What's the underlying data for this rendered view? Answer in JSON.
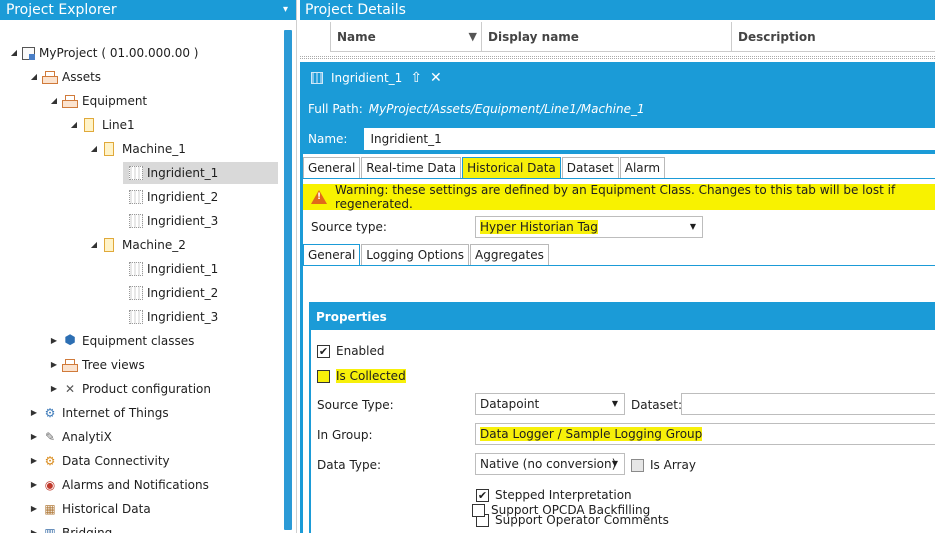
{
  "explorer": {
    "title": "Project Explorer",
    "pin": "▾",
    "nodes": [
      {
        "label": "MyProject ( 01.00.000.00 )",
        "icon": "project-icon",
        "expander": "◢"
      },
      {
        "label": "Assets",
        "icon": "assets-icon",
        "expander": "◢"
      },
      {
        "label": "Equipment",
        "icon": "equipment-icon",
        "expander": "◢"
      },
      {
        "label": "Line1",
        "icon": "line-icon",
        "expander": "◢"
      },
      {
        "label": "Machine_1",
        "icon": "machine-icon",
        "expander": "◢"
      },
      {
        "label": "Ingridient_1",
        "icon": "ingredient-icon",
        "selected": true
      },
      {
        "label": "Ingridient_2",
        "icon": "ingredient-icon"
      },
      {
        "label": "Ingridient_3",
        "icon": "ingredient-icon"
      },
      {
        "label": "Machine_2",
        "icon": "machine-icon",
        "expander": "◢"
      },
      {
        "label": "Ingridient_1",
        "icon": "ingredient-icon"
      },
      {
        "label": "Ingridient_2",
        "icon": "ingredient-icon"
      },
      {
        "label": "Ingridient_3",
        "icon": "ingredient-icon"
      },
      {
        "label": "Equipment classes",
        "icon": "equipment-classes-icon",
        "expander": "▶"
      },
      {
        "label": "Tree views",
        "icon": "tree-views-icon",
        "expander": "▶"
      },
      {
        "label": "Product configuration",
        "icon": "tools-icon",
        "expander": "▶"
      },
      {
        "label": "Internet of Things",
        "icon": "iot-icon",
        "expander": "▶"
      },
      {
        "label": "AnalytiX",
        "icon": "analytix-icon",
        "expander": "▶"
      },
      {
        "label": "Data Connectivity",
        "icon": "connectivity-icon",
        "expander": "▶"
      },
      {
        "label": "Alarms and Notifications",
        "icon": "alarm-icon",
        "expander": "▶"
      },
      {
        "label": "Historical Data",
        "icon": "historical-icon",
        "expander": "▶"
      },
      {
        "label": "Bridging",
        "icon": "bridging-icon",
        "expander": "▶"
      }
    ]
  },
  "details": {
    "title": "Project Details",
    "columns": [
      "Name",
      "Display name",
      "Description"
    ]
  },
  "document": {
    "tab_title": "Ingridient_1",
    "full_path_label": "Full Path:",
    "full_path_value": "MyProject/Assets/Equipment/Line1/Machine_1",
    "name_label": "Name:",
    "name_value": "Ingridient_1",
    "tabs": [
      "General",
      "Real-time Data",
      "Historical Data",
      "Dataset",
      "Alarm"
    ],
    "warning": "Warning: these settings are defined by an Equipment Class. Changes to this tab will be lost if regenerated.",
    "source_type_label": "Source type:",
    "source_type_value": "Hyper Historian Tag",
    "subtabs": [
      "General",
      "Logging Options",
      "Aggregates"
    ],
    "properties": {
      "header": "Properties",
      "enabled_label": "Enabled",
      "enabled_check": "✔",
      "is_collected_label": "Is Collected",
      "source_type_label": "Source Type:",
      "source_type_value": "Datapoint",
      "dataset_label": "Dataset:",
      "in_group_label": "In Group:",
      "in_group_value": "Data Logger / Sample Logging Group",
      "data_type_label": "Data Type:",
      "data_type_value": "Native (no conversion)",
      "is_array_label": "Is Array",
      "stepped_label": "Stepped Interpretation",
      "stepped_check": "✔",
      "operator_comments_label": "Support Operator Comments",
      "opcda_label": "Support OPCDA Backfilling"
    }
  },
  "colors": {
    "accent": "#1b9bd7",
    "highlight": "#f7f00a",
    "warning_bg": "#f8f200",
    "selection": "#d9d9d9"
  }
}
